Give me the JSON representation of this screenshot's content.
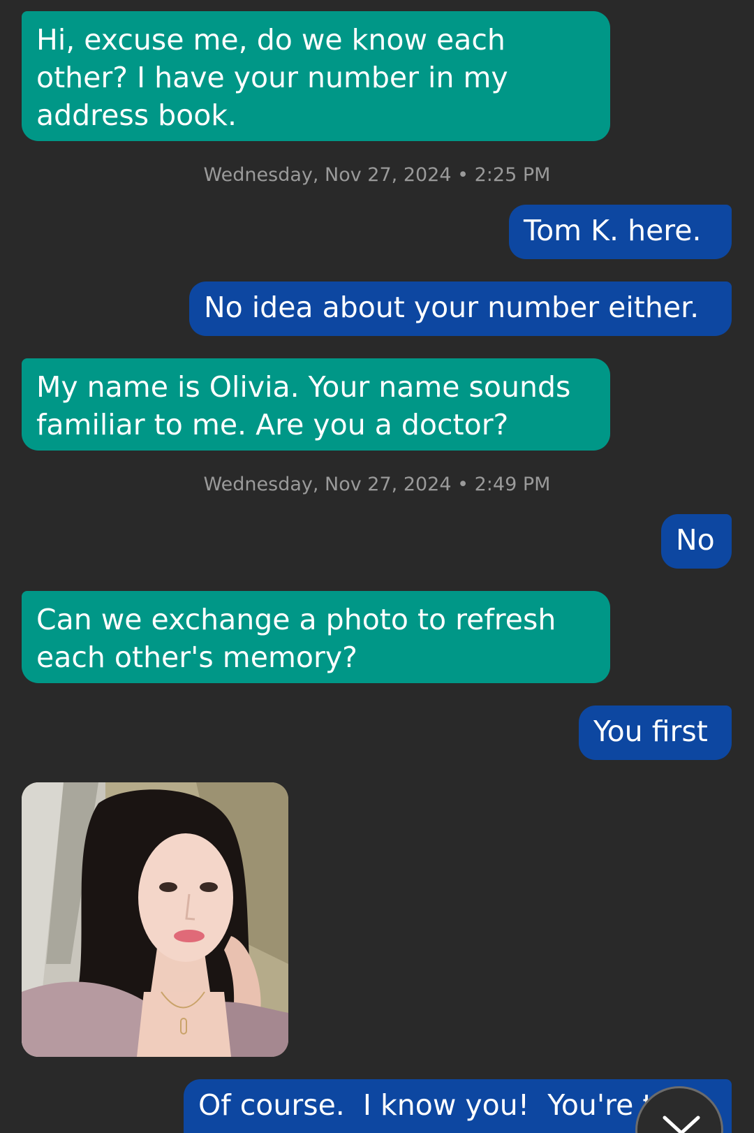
{
  "conversation": {
    "messages": [
      {
        "direction": "incoming",
        "text": "Hi, excuse me, do we know each\nother? I have your number in my\naddress book."
      },
      {
        "direction": "timestamp",
        "text": "Wednesday, Nov 27, 2024 • 2:25 PM"
      },
      {
        "direction": "outgoing",
        "text": "Tom K. here."
      },
      {
        "direction": "outgoing",
        "text": "No idea about your number either."
      },
      {
        "direction": "incoming",
        "text": "My name is Olivia. Your name sounds\nfamiliar to me. Are you a doctor?"
      },
      {
        "direction": "timestamp",
        "text": "Wednesday, Nov 27, 2024 • 2:49 PM"
      },
      {
        "direction": "outgoing",
        "text": "No"
      },
      {
        "direction": "incoming",
        "text": "Can we exchange a photo to refresh\neach other's memory?"
      },
      {
        "direction": "outgoing",
        "text": "You first"
      },
      {
        "direction": "incoming",
        "type": "image",
        "description": "selfie-photo"
      },
      {
        "direction": "outgoing",
        "text": "Of course.  I know you!  You're t"
      }
    ]
  },
  "colors": {
    "background": "#292929",
    "incoming_bubble": "#009787",
    "outgoing_bubble": "#0d47a1",
    "timestamp_text": "#9a9a9a"
  },
  "icons": {
    "scroll_down": "chevron-down-icon"
  }
}
